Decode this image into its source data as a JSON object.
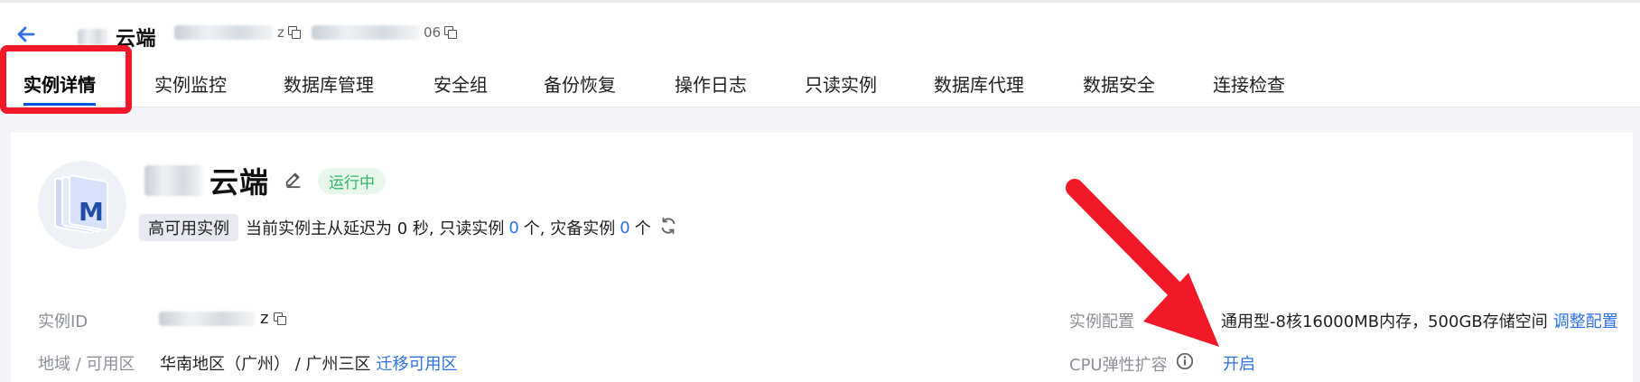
{
  "header": {
    "title_suffix": "云端",
    "id_tail": "z",
    "secondary_tail": "06"
  },
  "tabs": [
    {
      "label": "实例详情"
    },
    {
      "label": "实例监控"
    },
    {
      "label": "数据库管理"
    },
    {
      "label": "安全组"
    },
    {
      "label": "备份恢复"
    },
    {
      "label": "操作日志"
    },
    {
      "label": "只读实例"
    },
    {
      "label": "数据库代理"
    },
    {
      "label": "数据安全"
    },
    {
      "label": "连接检查"
    }
  ],
  "instance": {
    "name_suffix": "云端",
    "status": "运行中",
    "type_badge": "高可用实例",
    "delay_text": "当前实例主从延迟为 0 秒, 只读实例",
    "readonly_count": "0",
    "unit_1": "个, 灾备实例",
    "disaster_count": "0",
    "unit_2": "个",
    "avatar_letter": "M"
  },
  "details": {
    "instance_id_label": "实例ID",
    "instance_id_tail": "z",
    "region_label": "地域 / 可用区",
    "region_value": "华南地区（广州） / 广州三区",
    "migrate_link": "迁移可用区",
    "config_label": "实例配置",
    "config_value": "通用型-8核16000MB内存，500GB存储空间",
    "adjust_link": "调整配置",
    "cpu_label": "CPU弹性扩容",
    "cpu_link": "开启"
  },
  "colors": {
    "accent": "#2f6fe8",
    "status_green": "#2fb468",
    "annotation_red": "#f11927"
  }
}
